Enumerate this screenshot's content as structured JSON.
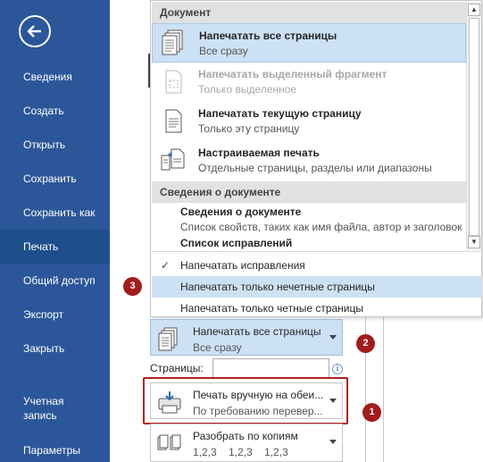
{
  "sidebar": {
    "items": [
      {
        "label": "Сведения"
      },
      {
        "label": "Создать"
      },
      {
        "label": "Открыть"
      },
      {
        "label": "Сохранить"
      },
      {
        "label": "Сохранить как"
      },
      {
        "label": "Печать"
      },
      {
        "label": "Общий доступ"
      },
      {
        "label": "Экспорт"
      },
      {
        "label": "Закрыть"
      },
      {
        "label": "Учетная\nзапись"
      },
      {
        "label": "Параметры"
      }
    ],
    "active": "Печать"
  },
  "popup": {
    "section_document": "Документ",
    "items": [
      {
        "title": "Напечатать все страницы",
        "subtitle": "Все сразу",
        "icon": "all-pages-icon"
      },
      {
        "title": "Напечатать выделенный фрагмент",
        "subtitle": "Только выделенное",
        "icon": "selection-icon"
      },
      {
        "title": "Напечатать текущую страницу",
        "subtitle": "Только эту страницу",
        "icon": "current-page-icon"
      },
      {
        "title": "Настраиваемая печать",
        "subtitle": "Отдельные страницы, разделы или диапазоны",
        "icon": "custom-print-icon"
      }
    ],
    "section_doc_info": "Сведения о документе",
    "doc_info_title": "Сведения о документе",
    "doc_info_sub": "Список свойств, таких как имя файла, автор и заголовок",
    "revisions_title": "Список исправлений",
    "options": [
      {
        "label": "Напечатать исправления",
        "checked": true
      },
      {
        "label": "Напечатать только нечетные страницы",
        "highlighted": true
      },
      {
        "label": "Напечатать только четные страницы"
      }
    ]
  },
  "settings": {
    "print_range": {
      "title": "Напечатать все страницы",
      "subtitle": "Все сразу"
    },
    "pages_label": "Страницы:",
    "pages_value": "",
    "duplex": {
      "title": "Печать вручную на обеи...",
      "subtitle": "По требованию перевер..."
    },
    "collate": {
      "title": "Разобрать по копиям",
      "subtitle": "1,2,3    1,2,3    1,2,3"
    }
  },
  "badges": {
    "b1": "1",
    "b2": "2",
    "b3": "3"
  },
  "colors": {
    "sidebar": "#2b579a",
    "highlight": "#cde1f5",
    "badge": "#a31c1c"
  }
}
